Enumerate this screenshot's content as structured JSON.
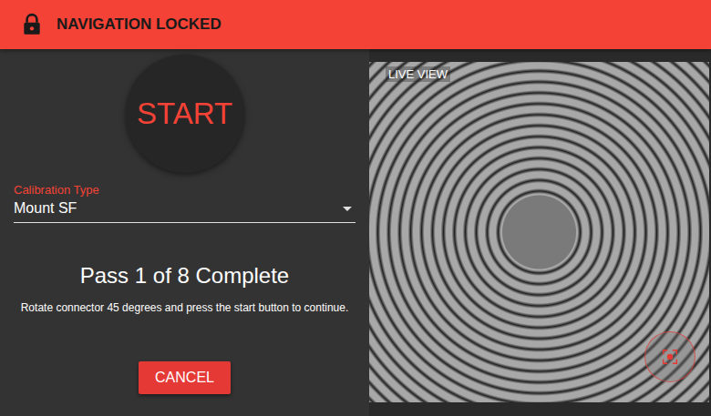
{
  "header": {
    "title": "NAVIGATION LOCKED",
    "locked": true
  },
  "start_button": {
    "label": "START"
  },
  "calibration": {
    "label": "Calibration Type",
    "value": "Mount SF"
  },
  "status": {
    "title": "Pass 1 of 8 Complete",
    "instruction": "Rotate connector 45 degrees and press the start button to continue."
  },
  "cancel_button": {
    "label": "CANCEL"
  },
  "live_view": {
    "label": "LIVE VIEW"
  }
}
